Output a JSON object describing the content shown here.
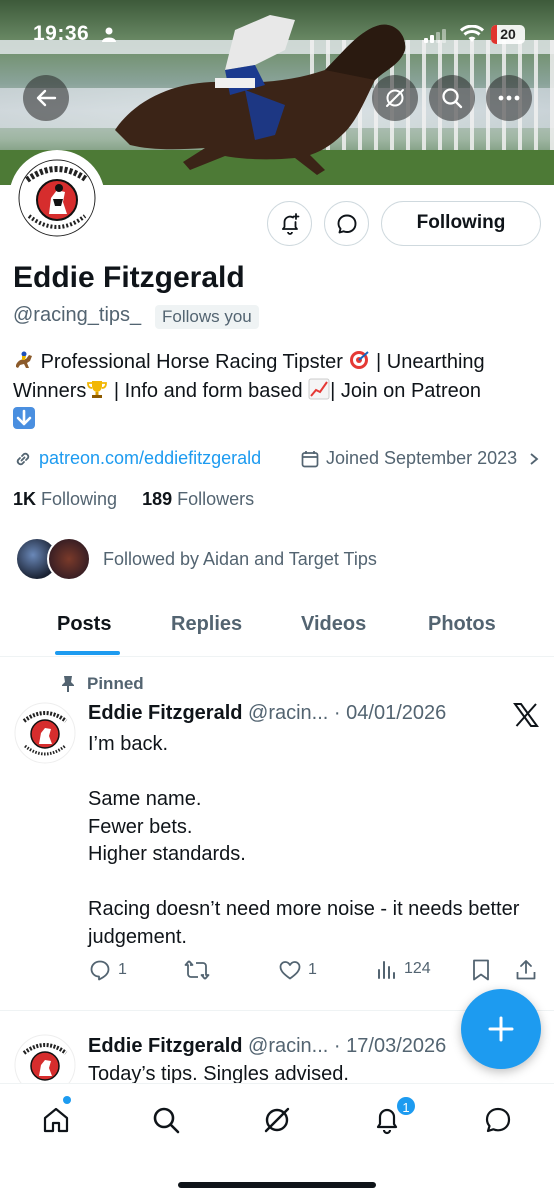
{
  "status_bar": {
    "time": "19:36",
    "battery": "20"
  },
  "profile": {
    "name": "Eddie Fitzgerald",
    "handle": "@racing_tips_",
    "follows_you": "Follows you",
    "following_button": "Following",
    "bio_line1": "Professional Horse Racing Tipster",
    "bio_line1b": "| Unearthing",
    "bio_line2a": "Winners",
    "bio_line2b": "| Info and form based",
    "bio_line2c": "| Join on Patreon",
    "link": "patreon.com/eddiefitzgerald",
    "joined": "Joined September 2023",
    "following_count": "1K",
    "following_label": "Following",
    "followers_count": "189",
    "followers_label": "Followers",
    "followed_by": "Followed by Aidan and Target Tips"
  },
  "tabs": [
    "Posts",
    "Replies",
    "Videos",
    "Photos"
  ],
  "pinned_post": {
    "pinned_label": "Pinned",
    "author": "Eddie Fitzgerald",
    "handle": "@racin...",
    "date": "· 04/01/2026",
    "text": "I’m back.\n\nSame name.\nFewer bets.\nHigher standards.\n\nRacing doesn’t need more noise - it needs better judgement.",
    "replies": "1",
    "likes": "1",
    "views": "124"
  },
  "second_post": {
    "author": "Eddie Fitzgerald",
    "handle": "@racin...",
    "date": "· 17/03/2026",
    "text": "Today’s tips. Singles advised."
  },
  "bottom_nav": {
    "notifications_badge": "1"
  },
  "colors": {
    "accent": "#1d9bf0",
    "text": "#0f1419",
    "muted": "#536471"
  }
}
